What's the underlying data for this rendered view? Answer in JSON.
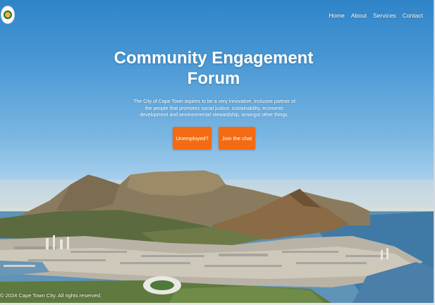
{
  "header": {
    "logo_alt": "City emblem",
    "nav": [
      {
        "label": "Home"
      },
      {
        "label": "About"
      },
      {
        "label": "Services"
      },
      {
        "label": "Contact"
      }
    ]
  },
  "hero": {
    "title": "Community Engagement Forum",
    "description": "The City of Cape Town aspires to be a very innovative, inclusive partner of the people that promotes social justice, sustainability, economic development and wnvironmental stewardship, amongst other things.",
    "buttons": {
      "unemployed": "Unemployed?",
      "chat": "Join the chat"
    }
  },
  "footer": {
    "copyright": "© 2024 Cape Town City. All rights reserved."
  },
  "colors": {
    "accent": "#f36b12",
    "sky_top": "#2f84c8",
    "text": "#ffffff"
  }
}
